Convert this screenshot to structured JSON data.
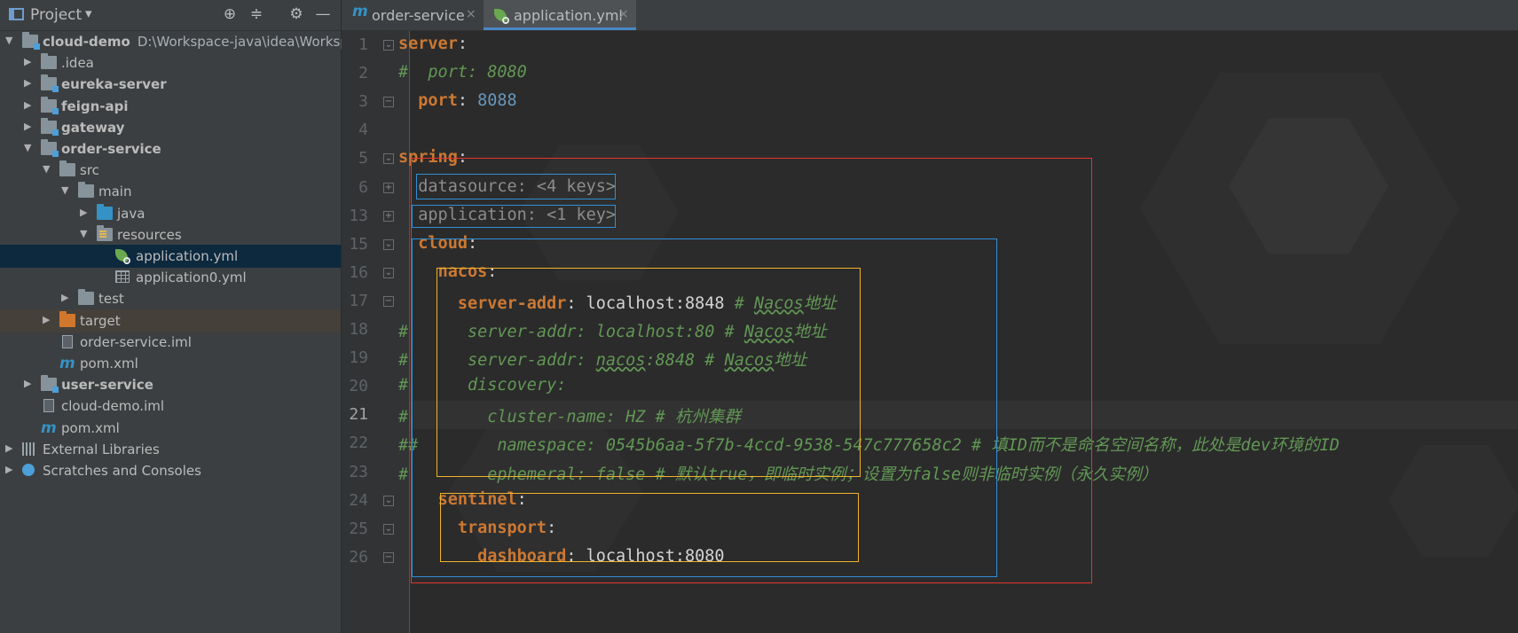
{
  "project_panel": {
    "title": "Project",
    "dropdown_glyph": "▾",
    "tree": [
      {
        "label": "cloud-demo",
        "path": "D:\\Workspace-java\\idea\\Workspa",
        "icon": "module-folder-icon",
        "expanded": true
      },
      {
        "label": ".idea",
        "icon": "folder-icon",
        "expanded": false
      },
      {
        "label": "eureka-server",
        "icon": "module-folder-icon",
        "expanded": false
      },
      {
        "label": "feign-api",
        "icon": "module-folder-icon",
        "expanded": false
      },
      {
        "label": "gateway",
        "icon": "module-folder-icon",
        "expanded": false
      },
      {
        "label": "order-service",
        "icon": "module-folder-icon",
        "expanded": true
      },
      {
        "label": "src",
        "icon": "folder-icon",
        "expanded": true
      },
      {
        "label": "main",
        "icon": "folder-icon",
        "expanded": true
      },
      {
        "label": "java",
        "icon": "source-folder-icon",
        "expanded": false
      },
      {
        "label": "resources",
        "icon": "resources-folder-icon",
        "expanded": true
      },
      {
        "label": "application.yml",
        "icon": "spring-yaml-icon",
        "selected": true
      },
      {
        "label": "application0.yml",
        "icon": "yaml-table-icon"
      },
      {
        "label": "test",
        "icon": "folder-icon",
        "expanded": false
      },
      {
        "label": "target",
        "icon": "excluded-folder-icon",
        "expanded": false
      },
      {
        "label": "order-service.iml",
        "icon": "iml-file-icon"
      },
      {
        "label": "pom.xml",
        "icon": "maven-icon"
      },
      {
        "label": "user-service",
        "icon": "module-folder-icon",
        "expanded": false
      },
      {
        "label": "cloud-demo.iml",
        "icon": "iml-file-icon"
      },
      {
        "label": "pom.xml",
        "icon": "maven-icon"
      },
      {
        "label": "External Libraries",
        "icon": "libraries-icon",
        "expanded": false
      },
      {
        "label": "Scratches and Consoles",
        "icon": "scratches-icon",
        "expanded": false
      }
    ]
  },
  "tabs": [
    {
      "label": "order-service",
      "icon": "maven-icon",
      "icon_glyph": "m",
      "close": "×"
    },
    {
      "label": "application.yml",
      "icon": "spring-yaml-icon",
      "close": "×",
      "active": true
    }
  ],
  "editor": {
    "lines": [
      {
        "num": "1",
        "tokens": [
          {
            "t": "server",
            "c": "k"
          },
          {
            "t": ":",
            "c": "s"
          }
        ],
        "fold": "open"
      },
      {
        "num": "2",
        "tokens": [
          {
            "t": "#  port: 8080",
            "c": "c"
          }
        ]
      },
      {
        "num": "3",
        "tokens": [
          {
            "t": "  "
          },
          {
            "t": "port",
            "c": "k"
          },
          {
            "t": ": ",
            "c": "s"
          },
          {
            "t": "8088",
            "c": "n"
          }
        ],
        "fold": "end"
      },
      {
        "num": "4",
        "tokens": []
      },
      {
        "num": "5",
        "tokens": [
          {
            "t": "spring",
            "c": "k"
          },
          {
            "t": ":",
            "c": "s"
          }
        ],
        "fold": "open"
      },
      {
        "num": "6",
        "tokens": [
          {
            "t": "  "
          },
          {
            "t": "datasource: <4 keys>",
            "c": "folded"
          }
        ],
        "fold": "plus"
      },
      {
        "num": "13",
        "tokens": [
          {
            "t": "  "
          },
          {
            "t": "application: <1 key>",
            "c": "folded"
          }
        ],
        "fold": "plus"
      },
      {
        "num": "15",
        "tokens": [
          {
            "t": "  "
          },
          {
            "t": "cloud",
            "c": "k"
          },
          {
            "t": ":",
            "c": "s"
          }
        ],
        "fold": "open"
      },
      {
        "num": "16",
        "tokens": [
          {
            "t": "    "
          },
          {
            "t": "nacos",
            "c": "k"
          },
          {
            "t": ":",
            "c": "s"
          }
        ],
        "fold": "open"
      },
      {
        "num": "17",
        "tokens": [
          {
            "t": "      "
          },
          {
            "t": "server-addr",
            "c": "k"
          },
          {
            "t": ": localhost:8848 ",
            "c": "s"
          },
          {
            "t": "# ",
            "c": "c"
          },
          {
            "t": "Nacos",
            "c": "c u"
          },
          {
            "t": "地址",
            "c": "c"
          }
        ],
        "fold": "end"
      },
      {
        "num": "18",
        "tokens": [
          {
            "t": "#      server-addr: localhost:80 # ",
            "c": "c"
          },
          {
            "t": "Nacos",
            "c": "c u"
          },
          {
            "t": "地址",
            "c": "c"
          }
        ]
      },
      {
        "num": "19",
        "tokens": [
          {
            "t": "#      server-addr: ",
            "c": "c"
          },
          {
            "t": "nacos",
            "c": "c u"
          },
          {
            "t": ":8848 # ",
            "c": "c"
          },
          {
            "t": "Nacos",
            "c": "c u"
          },
          {
            "t": "地址",
            "c": "c"
          }
        ]
      },
      {
        "num": "20",
        "tokens": [
          {
            "t": "#      discovery:",
            "c": "c"
          }
        ]
      },
      {
        "num": "21",
        "tokens": [
          {
            "t": "#        cluster-name: HZ # 杭州集群",
            "c": "c"
          }
        ],
        "current": true
      },
      {
        "num": "22",
        "tokens": [
          {
            "t": "##        namespace: 0545b6aa-5f7b-4ccd-9538-547c777658c2 # 填ID而不是命名空间名称，此处是dev环境的ID",
            "c": "c"
          }
        ]
      },
      {
        "num": "23",
        "tokens": [
          {
            "t": "#        ephemeral: false # 默认true，即临时实例；设置为false则非临时实例（永久实例）",
            "c": "c"
          }
        ]
      },
      {
        "num": "24",
        "tokens": [
          {
            "t": "    "
          },
          {
            "t": "sentinel",
            "c": "k"
          },
          {
            "t": ":",
            "c": "s"
          }
        ],
        "fold": "open"
      },
      {
        "num": "25",
        "tokens": [
          {
            "t": "      "
          },
          {
            "t": "transport",
            "c": "k"
          },
          {
            "t": ":",
            "c": "s"
          }
        ],
        "fold": "open"
      },
      {
        "num": "26",
        "tokens": [
          {
            "t": "        "
          },
          {
            "t": "dashboard",
            "c": "k"
          },
          {
            "t": ": localhost:8080",
            "c": "s"
          }
        ],
        "fold": "end"
      }
    ],
    "highlight_colors": {
      "outer": "#e8332e",
      "cloud": "#2f8fd8",
      "inner": "#f0b22a",
      "folded": "#2f8fd8"
    }
  }
}
